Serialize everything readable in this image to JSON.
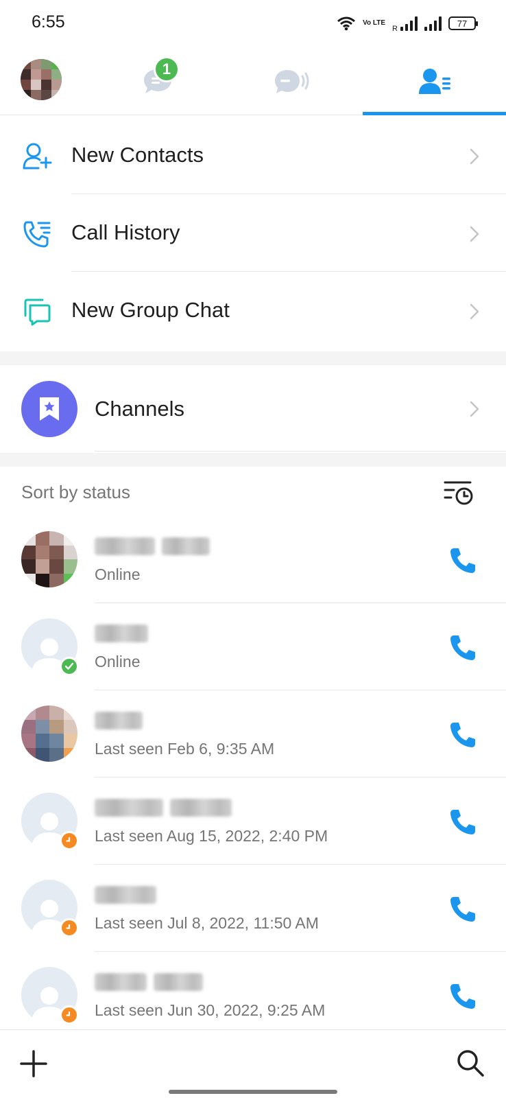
{
  "status_bar": {
    "time": "6:55",
    "battery": "77",
    "network": "Vo LTE",
    "roaming": "R"
  },
  "tabs": {
    "unread_badge": "1",
    "active_tab": "contacts",
    "icons": [
      "avatar",
      "chat-bubble-icon",
      "voice-room-icon",
      "contacts-list-icon"
    ]
  },
  "menu": {
    "new_contacts": "New Contacts",
    "call_history": "Call History",
    "new_group_chat": "New Group Chat",
    "channels": "Channels"
  },
  "sort": {
    "label": "Sort by status"
  },
  "contacts": [
    {
      "status_text": "Online",
      "presence": "online"
    },
    {
      "status_text": "Online",
      "presence": "online"
    },
    {
      "status_text": "Last seen Feb 6, 9:35 AM",
      "presence": "away"
    },
    {
      "status_text": "Last seen Aug 15, 2022, 2:40 PM",
      "presence": "away"
    },
    {
      "status_text": "Last seen Jul 8, 2022, 11:50 AM",
      "presence": "away"
    },
    {
      "status_text": "Last seen Jun 30, 2022, 9:25 AM",
      "presence": "away"
    }
  ],
  "colors": {
    "accent": "#1a96ee",
    "group_chat_icon": "#19c3b4",
    "channels_bg": "#6a6cf0",
    "online": "#4cb953",
    "away": "#f58a22",
    "badge": "#4cb953"
  }
}
